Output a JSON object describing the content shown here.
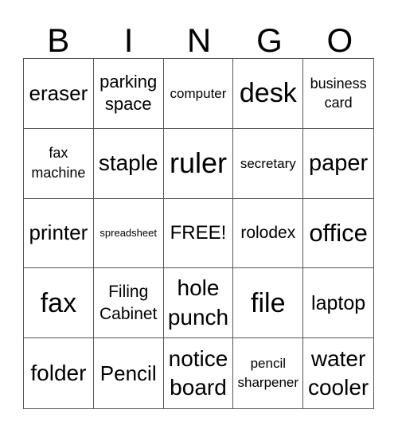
{
  "header": [
    "B",
    "I",
    "N",
    "G",
    "O"
  ],
  "cells": [
    "eraser",
    "parking space",
    "computer",
    "desk",
    "business card",
    "fax machine",
    "staple",
    "ruler",
    "secretary",
    "paper",
    "printer",
    "spreadsheet",
    "FREE!",
    "rolodex",
    "office",
    "fax",
    "Filing Cabinet",
    "hole punch",
    "file",
    "laptop",
    "folder",
    "Pencil",
    "notice board",
    "pencil sharpener",
    "water cooler"
  ]
}
